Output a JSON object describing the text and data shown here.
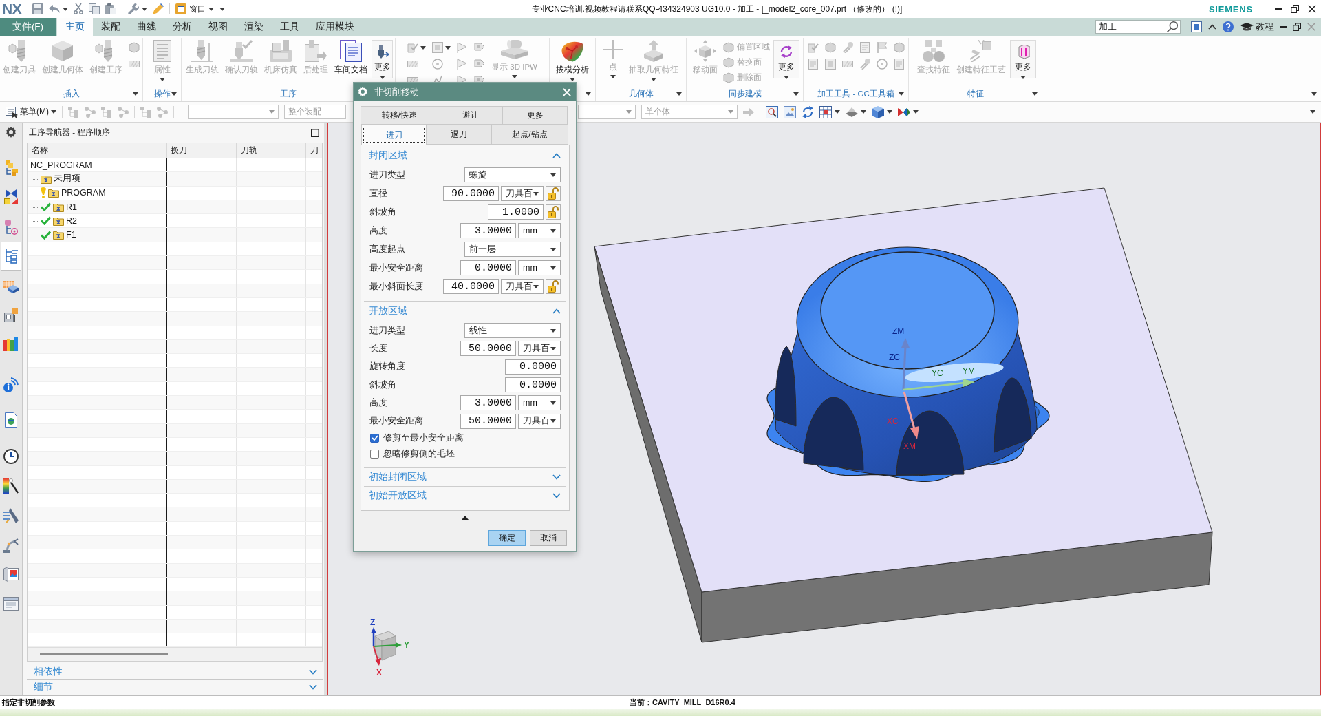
{
  "title_bar": {
    "logo": "NX",
    "window_menu": "窗口",
    "title": "专业CNC培训.视频教程请联系QQ-434324903 UG10.0 - 加工 - [_model2_core_007.prt （修改的） (!)]",
    "brand": "SIEMENS"
  },
  "menu_tabs": [
    {
      "label": "文件(F)",
      "kind": "file",
      "selected": false
    },
    {
      "label": "主页",
      "kind": "tab",
      "selected": true
    },
    {
      "label": "装配",
      "kind": "tab",
      "selected": false
    },
    {
      "label": "曲线",
      "kind": "tab",
      "selected": false
    },
    {
      "label": "分析",
      "kind": "tab",
      "selected": false
    },
    {
      "label": "视图",
      "kind": "tab",
      "selected": false
    },
    {
      "label": "渲染",
      "kind": "tab",
      "selected": false
    },
    {
      "label": "工具",
      "kind": "tab",
      "selected": false
    },
    {
      "label": "应用模块",
      "kind": "tab",
      "selected": false
    }
  ],
  "command_search": {
    "value": "加工"
  },
  "help_menu": {
    "label": "教程"
  },
  "ribbon_groups": [
    {
      "label": "插入",
      "buttons": [
        {
          "label": "创建刀具",
          "kind": "large",
          "disabled": true,
          "dropdown": false
        },
        {
          "label": "创建几何体",
          "kind": "large",
          "disabled": true,
          "dropdown": false
        },
        {
          "label": "创建工序",
          "kind": "large",
          "disabled": true,
          "dropdown": false
        }
      ]
    },
    {
      "label": "操作",
      "buttons": [
        {
          "label": "属性",
          "kind": "large",
          "disabled": true,
          "dropdown": true
        }
      ]
    },
    {
      "label": "工序",
      "buttons": [
        {
          "label": "生成刀轨",
          "kind": "large",
          "disabled": true,
          "dropdown": false
        },
        {
          "label": "确认刀轨",
          "kind": "large",
          "disabled": true,
          "dropdown": false
        },
        {
          "label": "机床仿真",
          "kind": "large",
          "disabled": true,
          "dropdown": false
        },
        {
          "label": "后处理",
          "kind": "large",
          "disabled": true,
          "dropdown": false
        },
        {
          "label": "车间文档",
          "kind": "large",
          "disabled": false,
          "dropdown": false
        },
        {
          "label": "更多",
          "kind": "more",
          "disabled": false,
          "dropdown": true
        }
      ]
    },
    {
      "buttons": [
        {
          "label": "显示 3D IPW",
          "kind": "large",
          "disabled": true,
          "dropdown": true
        }
      ]
    },
    {
      "buttons": [
        {
          "label": "拔模分析",
          "kind": "large",
          "disabled": false,
          "dropdown": true
        }
      ]
    },
    {
      "label": "几何体",
      "buttons": [
        {
          "label": "点",
          "kind": "large",
          "disabled": true,
          "dropdown": true
        },
        {
          "label": "抽取几何特征",
          "kind": "large",
          "disabled": true,
          "dropdown": true
        }
      ]
    },
    {
      "label": "同步建模",
      "buttons": [
        {
          "label": "移动面",
          "kind": "large",
          "disabled": true,
          "dropdown": false
        },
        {
          "label": "偏置区域",
          "kind": "small",
          "disabled": true,
          "dropdown": false
        },
        {
          "label": "替换面",
          "kind": "small",
          "disabled": true,
          "dropdown": false
        },
        {
          "label": "删除面",
          "kind": "small",
          "disabled": true,
          "dropdown": false
        },
        {
          "label": "更多",
          "kind": "more",
          "disabled": false,
          "dropdown": true
        }
      ]
    },
    {
      "label": "加工工具 - GC工具箱"
    },
    {
      "label": "特征",
      "buttons": [
        {
          "label": "查找特征",
          "kind": "large",
          "disabled": true,
          "dropdown": false
        },
        {
          "label": "创建特征工艺",
          "kind": "large",
          "disabled": true,
          "dropdown": false
        },
        {
          "label": "更多",
          "kind": "more",
          "disabled": false,
          "dropdown": true
        }
      ]
    }
  ],
  "toolbar": {
    "menu_button": "菜单(M)",
    "filters": [
      {
        "value": "整个装配",
        "disabled": true
      },
      {
        "value": "单个体",
        "disabled": true
      }
    ]
  },
  "resource_tabs": [
    {
      "selected": false
    },
    {
      "selected": false
    },
    {
      "selected": false
    },
    {
      "selected": true
    },
    {
      "selected": false
    },
    {
      "selected": false
    },
    {
      "selected": false
    },
    {
      "selected": false
    },
    {
      "selected": false
    },
    {
      "selected": false
    },
    {
      "selected": false
    },
    {
      "selected": false
    },
    {
      "selected": false
    },
    {
      "selected": false
    },
    {
      "selected": false
    }
  ],
  "navigator": {
    "title": "工序导航器 - 程序顺序",
    "columns": [
      "名称",
      "换刀",
      "刀轨",
      "刀"
    ],
    "tree": [
      {
        "name": "NC_PROGRAM",
        "children": [
          {
            "name": "未用项",
            "warning": false,
            "done": false
          },
          {
            "name": "PROGRAM",
            "warning": true,
            "done": false
          },
          {
            "name": "R1",
            "warning": false,
            "done": true
          },
          {
            "name": "R2",
            "warning": false,
            "done": true
          },
          {
            "name": "F1",
            "warning": false,
            "done": true
          }
        ]
      }
    ],
    "sections": [
      {
        "label": "相依性",
        "expanded": false
      },
      {
        "label": "细节",
        "expanded": false
      }
    ]
  },
  "viewport": {
    "axis_labels": [
      {
        "label": "ZM",
        "color": "#0a2288"
      },
      {
        "label": "ZC",
        "color": "#0a2288"
      },
      {
        "label": "YC",
        "color": "#0e6a1c"
      },
      {
        "label": "YM",
        "color": "#0e6a1c"
      },
      {
        "label": "XC",
        "color": "#d7263d"
      },
      {
        "label": "XM",
        "color": "#d7263d"
      }
    ],
    "view_triad": [
      {
        "label": "Z",
        "color": "#1f3fbf"
      },
      {
        "label": "Y",
        "color": "#2e9e3a"
      },
      {
        "label": "X",
        "color": "#d7263d"
      }
    ]
  },
  "status_bar": {
    "prompt": "指定非切削参数",
    "current": "当前：CAVITY_MILL_D16R0.4"
  },
  "dialog": {
    "title": "非切削移动",
    "tab_rows": [
      {
        "tabs": [
          {
            "label": "转移/快速",
            "selected": false
          },
          {
            "label": "避让",
            "selected": false
          },
          {
            "label": "更多",
            "selected": false
          }
        ]
      },
      {
        "tabs": [
          {
            "label": "进刀",
            "selected": true
          },
          {
            "label": "退刀",
            "selected": false
          },
          {
            "label": "起点/钻点",
            "selected": false
          }
        ]
      }
    ],
    "sections": [
      {
        "title": "封闭区域",
        "expanded": true,
        "fields": [
          {
            "label": "进刀类型",
            "kind": "select",
            "value": "螺旋"
          },
          {
            "label": "直径",
            "kind": "number",
            "value": "90.0000",
            "unit": "刀具百",
            "locked": false
          },
          {
            "label": "斜坡角",
            "kind": "number",
            "value": "1.0000",
            "locked": false
          },
          {
            "label": "高度",
            "kind": "number",
            "value": "3.0000",
            "unit": "mm"
          },
          {
            "label": "高度起点",
            "kind": "select",
            "value": "前一层"
          },
          {
            "label": "最小安全距离",
            "kind": "number",
            "value": "0.0000",
            "unit": "mm"
          },
          {
            "label": "最小斜面长度",
            "kind": "number",
            "value": "40.0000",
            "unit": "刀具百",
            "locked": false
          }
        ]
      },
      {
        "title": "开放区域",
        "expanded": true,
        "fields": [
          {
            "label": "进刀类型",
            "kind": "select",
            "value": "线性"
          },
          {
            "label": "长度",
            "kind": "number",
            "value": "50.0000",
            "unit": "刀具百"
          },
          {
            "label": "旋转角度",
            "kind": "number",
            "value": "0.0000"
          },
          {
            "label": "斜坡角",
            "kind": "number",
            "value": "0.0000"
          },
          {
            "label": "高度",
            "kind": "number",
            "value": "3.0000",
            "unit": "mm"
          },
          {
            "label": "最小安全距离",
            "kind": "number",
            "value": "50.0000",
            "unit": "刀具百"
          },
          {
            "label": "修剪至最小安全距离",
            "kind": "checkbox",
            "checked": true
          },
          {
            "label": "忽略修剪侧的毛坯",
            "kind": "checkbox",
            "checked": false
          }
        ]
      },
      {
        "title": "初始封闭区域",
        "expanded": false
      },
      {
        "title": "初始开放区域",
        "expanded": false
      }
    ],
    "buttons": [
      {
        "label": "确定",
        "kind": "primary"
      },
      {
        "label": "取消",
        "kind": "secondary"
      }
    ]
  }
}
